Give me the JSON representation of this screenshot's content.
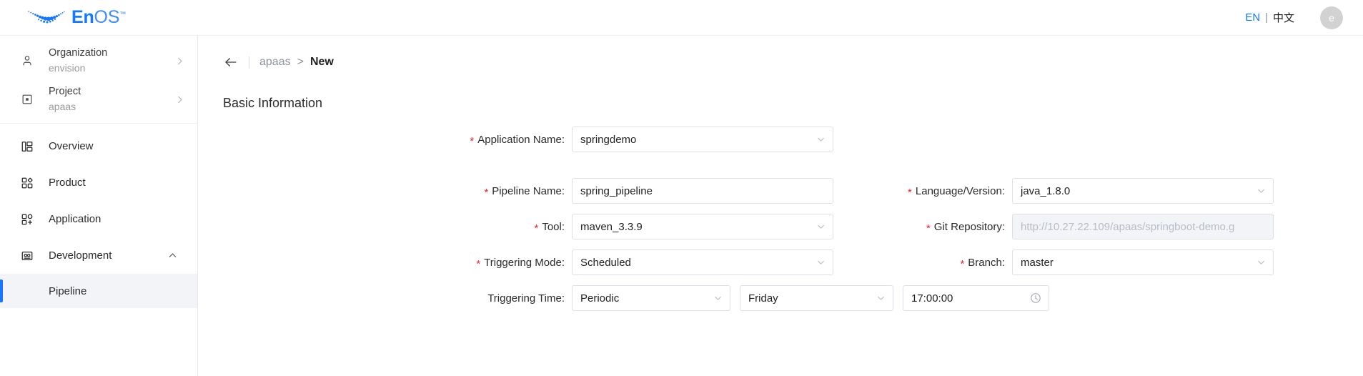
{
  "header": {
    "brand_main": "En",
    "brand_sub": "OS",
    "brand_tm": "™",
    "lang_en": "EN",
    "lang_sep": "|",
    "lang_cn": "中文",
    "avatar_initial": "e",
    "accent_color": "#1677ff"
  },
  "sidebar": {
    "context": [
      {
        "title": "Organization",
        "sub": "envision",
        "icon": "user-icon"
      },
      {
        "title": "Project",
        "sub": "apaas",
        "icon": "project-icon"
      }
    ],
    "nav": [
      {
        "label": "Overview",
        "icon": "overview-icon"
      },
      {
        "label": "Product",
        "icon": "product-icon"
      },
      {
        "label": "Application",
        "icon": "application-icon"
      },
      {
        "label": "Development",
        "icon": "development-icon",
        "expanded": true
      }
    ],
    "sub_items": [
      {
        "label": "Pipeline",
        "active": true
      }
    ]
  },
  "breadcrumb": {
    "back_icon": "arrow-left-icon",
    "parent": "apaas",
    "separator": ">",
    "current": "New"
  },
  "main": {
    "section_title": "Basic Information",
    "application_name": {
      "label": "Application Name:",
      "required": true,
      "value": "springdemo",
      "control": "select"
    },
    "left_fields": [
      {
        "label": "Pipeline Name:",
        "required": true,
        "value": "spring_pipeline",
        "control": "input"
      },
      {
        "label": "Tool:",
        "required": true,
        "value": "maven_3.3.9",
        "control": "select"
      },
      {
        "label": "Triggering Mode:",
        "required": true,
        "value": "Scheduled",
        "control": "select"
      }
    ],
    "right_fields": [
      {
        "label": "Language/Version:",
        "required": true,
        "value": "java_1.8.0",
        "control": "select"
      },
      {
        "label": "Git Repository:",
        "required": true,
        "value": "http://10.27.22.109/apaas/springboot-demo.g",
        "control": "input",
        "disabled": true
      },
      {
        "label": "Branch:",
        "required": true,
        "value": "master",
        "control": "select"
      }
    ],
    "triggering_time": {
      "label": "Triggering Time:",
      "required": false,
      "frequency": "Periodic",
      "day": "Friday",
      "time": "17:00:00",
      "time_icon": "clock-icon"
    }
  }
}
